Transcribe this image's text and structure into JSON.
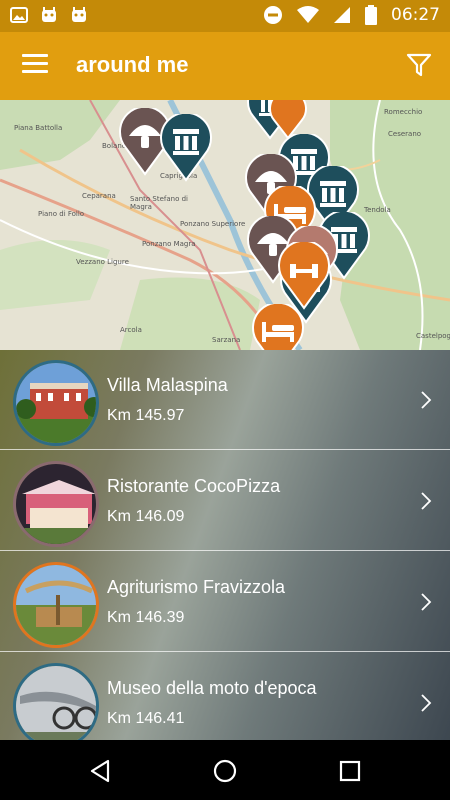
{
  "status_bar": {
    "time": "06:27",
    "icons": [
      "image-icon",
      "android-icon",
      "android-icon",
      "do-not-disturb-icon",
      "wifi-icon",
      "signal-icon",
      "battery-icon"
    ]
  },
  "app_bar": {
    "title": "around me",
    "menu_icon": "hamburger-menu-icon",
    "filter_icon": "filter-funnel-icon"
  },
  "map": {
    "place_labels": [
      "Piana Battolla",
      "Bolano",
      "Caprigliola",
      "Ceparana",
      "Santo Stefano di Magra",
      "Piano di Follo",
      "Ponzano Superiore",
      "Ponzano Magra",
      "Vezzano Ligure",
      "Arcola",
      "Sarzana",
      "Tendola",
      "Ceserano",
      "Romecchio",
      "Castelpog"
    ],
    "pin_types": [
      "mushroom-pin",
      "museum-pin",
      "bed-pin",
      "dumbbell-pin"
    ],
    "colors": {
      "museum": "#1e4e5c",
      "mushroom": "#6a5452",
      "bed": "#e0751f",
      "dumbbell": "#b47a6e"
    }
  },
  "list": {
    "items": [
      {
        "name": "Villa Malaspina",
        "distance": "Km 145.97",
        "border": "#2e6b84",
        "thumb": "villa"
      },
      {
        "name": "Ristorante CocoPizza",
        "distance": "Km 146.09",
        "border": "#8a6a6f",
        "thumb": "restaurant"
      },
      {
        "name": "Agriturismo Fravizzola",
        "distance": "Km 146.39",
        "border": "#e0751f",
        "thumb": "farm"
      },
      {
        "name": "Museo della moto d'epoca",
        "distance": "Km 146.41",
        "border": "#2e6b84",
        "thumb": "museum"
      }
    ]
  },
  "nav_bar": {
    "icons": [
      "back-icon",
      "home-icon",
      "recents-icon"
    ]
  }
}
